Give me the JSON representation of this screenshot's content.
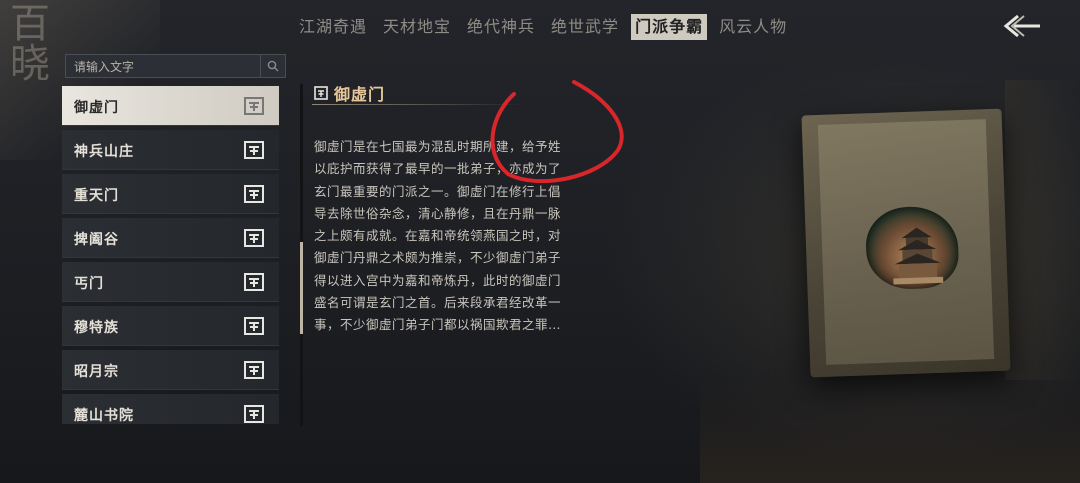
{
  "corner_text": "百晓",
  "tabs": [
    {
      "label": "江湖奇遇",
      "active": false
    },
    {
      "label": "天材地宝",
      "active": false
    },
    {
      "label": "绝代神兵",
      "active": false
    },
    {
      "label": "绝世武学",
      "active": false
    },
    {
      "label": "门派争霸",
      "active": true
    },
    {
      "label": "风云人物",
      "active": false
    }
  ],
  "search": {
    "placeholder": "请输入文字",
    "value": ""
  },
  "sects": [
    {
      "label": "御虚门",
      "selected": true
    },
    {
      "label": "神兵山庄",
      "selected": false
    },
    {
      "label": "重天门",
      "selected": false
    },
    {
      "label": "捭阖谷",
      "selected": false
    },
    {
      "label": "丐门",
      "selected": false
    },
    {
      "label": "穆特族",
      "selected": false
    },
    {
      "label": "昭月宗",
      "selected": false
    },
    {
      "label": "麓山书院",
      "selected": false
    }
  ],
  "detail": {
    "title": "御虚门",
    "lines": [
      "御虚门是在七国最为混乱时期所建，给予姓",
      "以庇护而获得了最早的一批弟子，亦成为了",
      "玄门最重要的门派之一。御虚门在修行上倡",
      "导去除世俗杂念，清心静修，且在丹鼎一脉",
      "之上颇有成就。在嘉和帝统领燕国之时，对",
      "御虚门丹鼎之术颇为推崇，不少御虚门弟子",
      "得以进入宫中为嘉和帝炼丹，此时的御虚门",
      "盛名可谓是玄门之首。后来段承君经改革一",
      "事，不少御虚门弟子门都以祸国欺君之罪…"
    ]
  },
  "colors": {
    "accent_title": "#e8c89a",
    "annotation": "#d8262b",
    "active_tab_bg": "#cfcac0"
  },
  "icons": {
    "back": "back-arrow-icon",
    "search": "search-icon",
    "emblem": "sect-emblem-icon"
  }
}
